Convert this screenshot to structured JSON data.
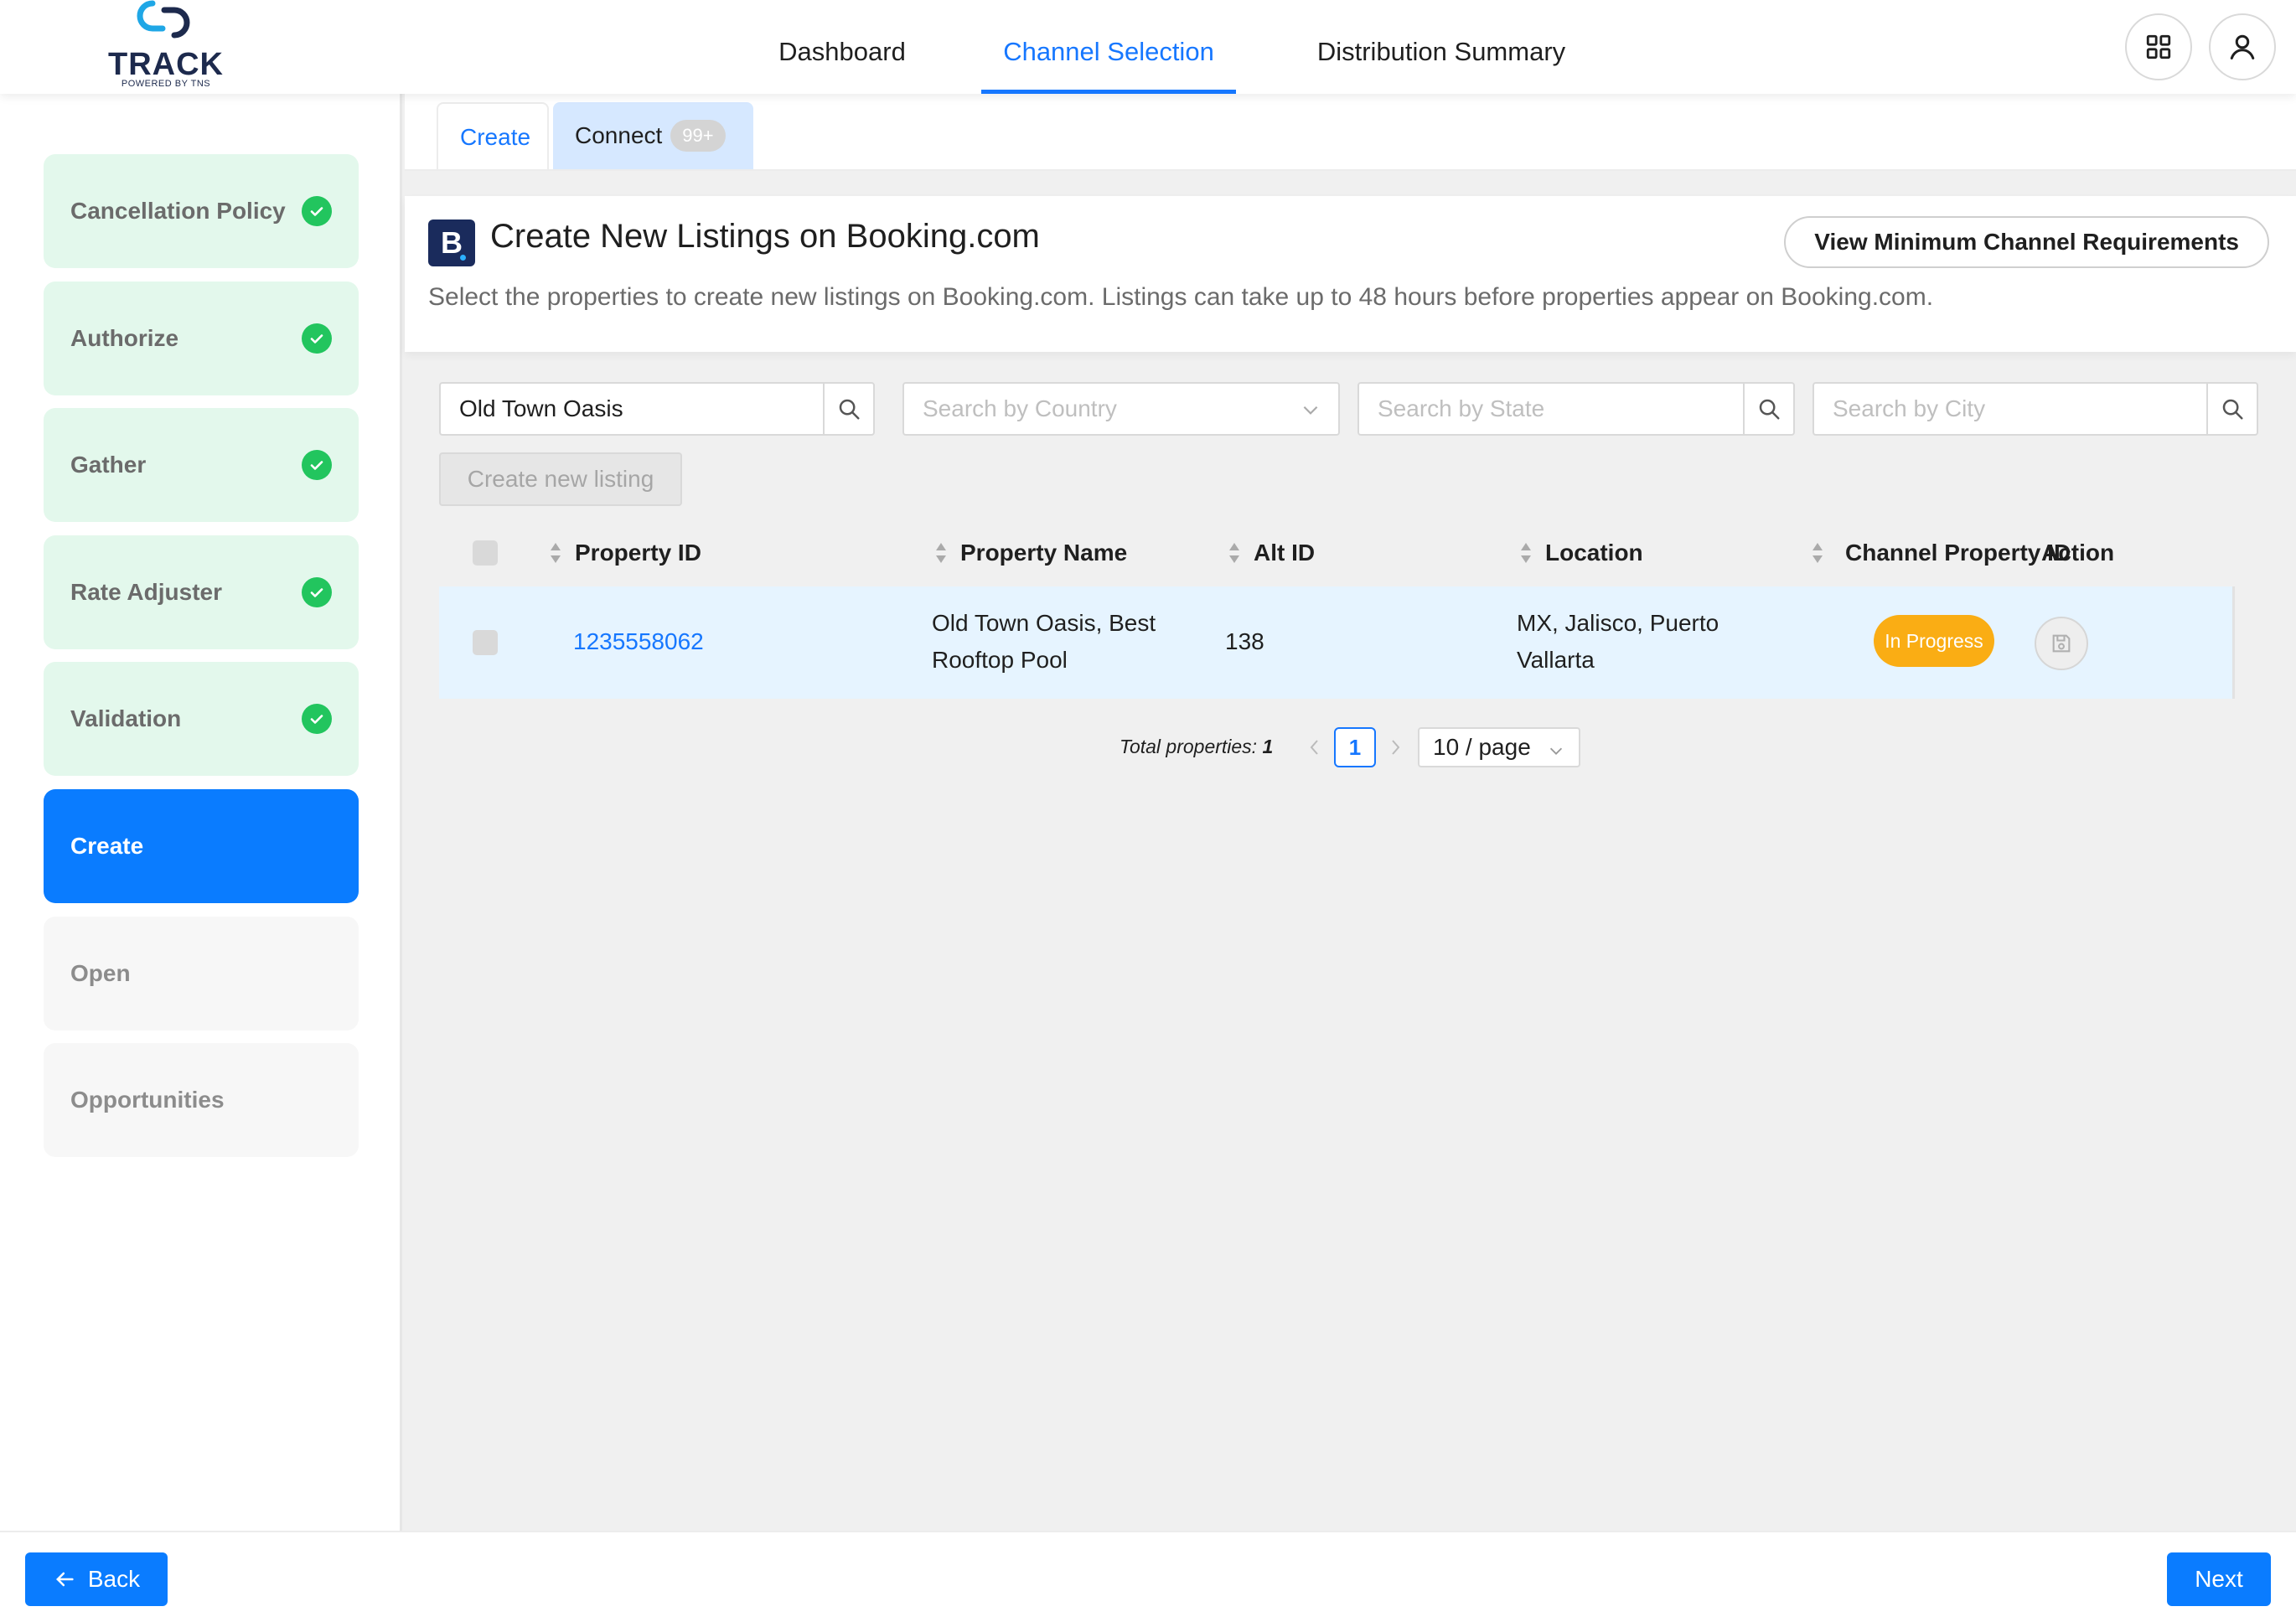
{
  "app": {
    "logo_word": "TRACK",
    "logo_sub": "POWERED BY TNS"
  },
  "nav": {
    "items": [
      {
        "label": "Dashboard"
      },
      {
        "label": "Channel Selection"
      },
      {
        "label": "Distribution Summary"
      }
    ],
    "active": "Channel Selection"
  },
  "header_icons": [
    "apps-grid-icon",
    "user-icon"
  ],
  "sidebar": {
    "steps": [
      {
        "label": "Cancellation Policy",
        "state": "done"
      },
      {
        "label": "Authorize",
        "state": "done"
      },
      {
        "label": "Gather",
        "state": "done"
      },
      {
        "label": "Rate Adjuster",
        "state": "done"
      },
      {
        "label": "Validation",
        "state": "done"
      },
      {
        "label": "Create",
        "state": "active"
      },
      {
        "label": "Open",
        "state": "todo"
      },
      {
        "label": "Opportunities",
        "state": "todo"
      }
    ]
  },
  "tabs": {
    "create": "Create",
    "connect": "Connect",
    "connect_badge": "99+"
  },
  "card": {
    "logo_letter": "B",
    "title": "Create New Listings on Booking.com",
    "description": "Select the properties to create new listings on Booking.com. Listings can take up to 48 hours before properties appear on Booking.com.",
    "requirements_button": "View Minimum Channel Requirements"
  },
  "filters": {
    "search_value": "Old Town Oasis",
    "country_placeholder": "Search by Country",
    "state_placeholder": "Search by State",
    "city_placeholder": "Search by City",
    "create_listing_button": "Create new listing"
  },
  "table": {
    "columns": {
      "property_id": "Property ID",
      "property_name": "Property Name",
      "alt_id": "Alt ID",
      "location": "Location",
      "channel_property_id": "Channel Property ID",
      "action": "Action"
    },
    "rows": [
      {
        "property_id": "1235558062",
        "property_name_line1": "Old Town Oasis, Best",
        "property_name_line2": "Rooftop Pool",
        "alt_id": "138",
        "location_line1": "MX, Jalisco, Puerto",
        "location_line2": "Vallarta",
        "status": "In Progress"
      }
    ]
  },
  "pagination": {
    "total_label": "Total properties:",
    "total_count": "1",
    "current_page": "1",
    "page_size": "10 / page"
  },
  "footer": {
    "back": "Back",
    "next": "Next"
  },
  "colors": {
    "accent": "#1677ff",
    "primary_button": "#0a7cff",
    "step_done_bg": "#e3f8ec",
    "check_green": "#22c55e",
    "status_orange": "#faad14",
    "booking_navy": "#1a2b5c"
  }
}
